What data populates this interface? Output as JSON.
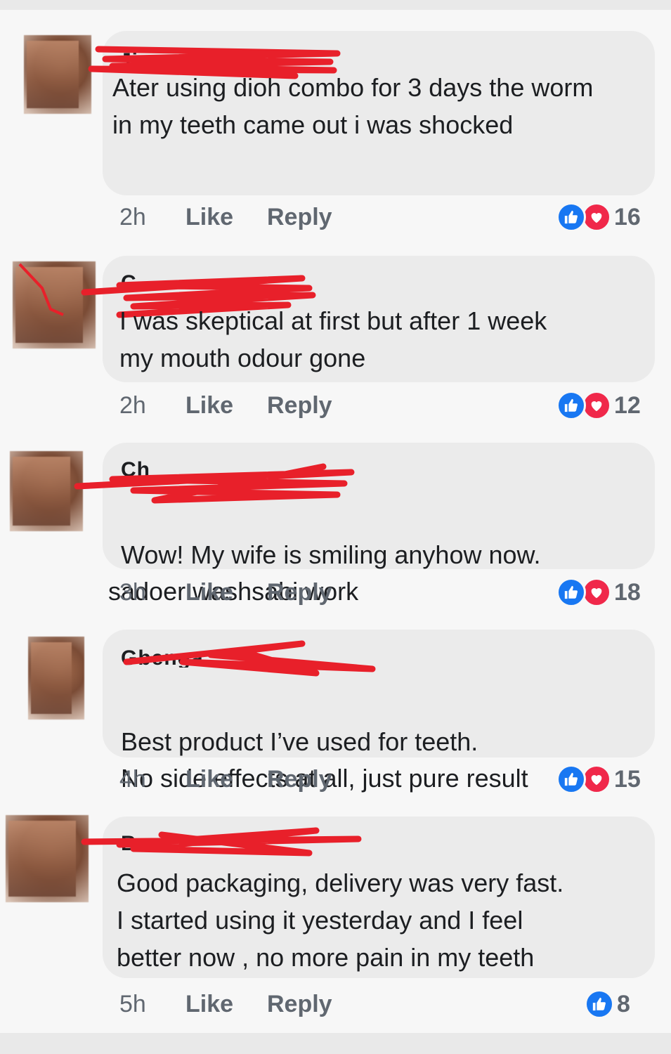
{
  "comments": [
    {
      "name": "Ji",
      "text": "Ater using dioh combo for 3 days the worm\nin my teeth came out i was shocked",
      "time": "2h",
      "like_label": "Like",
      "reply_label": "Reply",
      "reaction_count": "16",
      "reactions": [
        "like-icon",
        "love-icon"
      ]
    },
    {
      "name": "C",
      "text": "I was skeptical at first but after 1 week\nmy mouth odour gone",
      "time": "2h",
      "like_label": "Like",
      "reply_label": "Reply",
      "reaction_count": "12",
      "reactions": [
        "like-icon",
        "love-icon"
      ]
    },
    {
      "name": "Ch",
      "text_line1": "Wow! My wife is smiling anyhow now.",
      "text_line2": "sadoer washsabi work",
      "time": "3h",
      "like_label": "Like",
      "reply_label": "Reply",
      "reaction_count": "18",
      "reactions": [
        "like-icon",
        "love-icon"
      ]
    },
    {
      "name": "Gbenga",
      "text_line1": "Best product I’ve used for teeth.",
      "text_line2": "No side effects at all, just pure result",
      "time": "4h",
      "like_label": "Like",
      "reply_label": "Reply",
      "reaction_count": "15",
      "reactions": [
        "like-icon",
        "love-icon"
      ]
    },
    {
      "name": "B",
      "text": "Good packaging, delivery was very fast.\nI started using it yesterday and I feel\nbetter now , no more pain in my teeth",
      "time": "5h",
      "like_label": "Like",
      "reply_label": "Reply",
      "reaction_count": "8",
      "reactions": [
        "like-icon"
      ]
    }
  ],
  "colors": {
    "like_blue": "#1877f2",
    "love_red": "#f0284a",
    "redaction_red": "#e8202a"
  }
}
